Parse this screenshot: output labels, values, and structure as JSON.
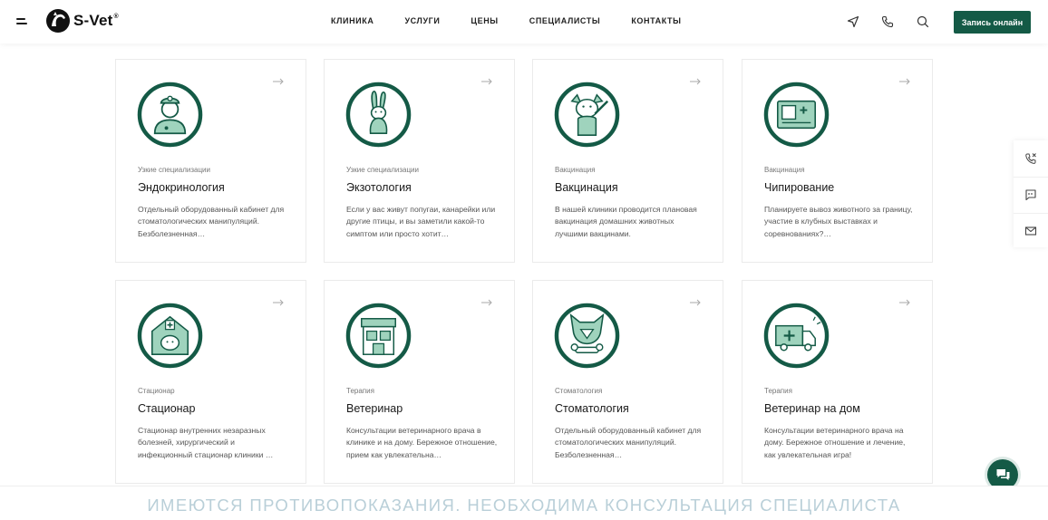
{
  "header": {
    "brand": "S-Vet",
    "brand_mark": "®",
    "nav": [
      "КЛИНИКА",
      "УСЛУГИ",
      "ЦЕНЫ",
      "СПЕЦИАЛИСТЫ",
      "КОНТАКТЫ"
    ],
    "cta_label": "Запись онлайн",
    "icons": [
      "location-arrow-icon",
      "phone-icon",
      "search-icon"
    ]
  },
  "cards": [
    {
      "category": "Узкие специализации",
      "title": "Эндокринология",
      "desc": "Отдельный оборудованный кабинет для стоматологических манипуляций. Безболезненная…",
      "icon": "doctor-icon"
    },
    {
      "category": "Узкие специализации",
      "title": "Экзотология",
      "desc": "Если у вас живут попугаи, канарейки или другие птицы, и вы заметили какой-то симптом или просто хотит…",
      "icon": "rabbit-icon"
    },
    {
      "category": "Вакцинация",
      "title": "Вакцинация",
      "desc": "В  нашей клиники проводится плановая вакцинация домашних животных лучшими вакцинами.",
      "icon": "dog-syringe-icon"
    },
    {
      "category": "Вакцинация",
      "title": "Чипирование",
      "desc": "Планируете вывоз животного за границу, участие в клубных выставках и соревнованиях?…",
      "icon": "pet-passport-icon"
    },
    {
      "category": "Стационар",
      "title": "Стационар",
      "desc": "Стационар внутренних незаразных болезней, хирургический и инфекционный стационар клиники …",
      "icon": "pet-hospital-icon"
    },
    {
      "category": "Терапия",
      "title": "Ветеринар",
      "desc": "Консультации ветеринарного врача в клинике и на дому. Бережное отношение, прием как увлекательна…",
      "icon": "vet-building-icon"
    },
    {
      "category": "Стоматология",
      "title": "Стоматология",
      "desc": "Отдельный оборудованный кабинет для стоматологических манипуляций. Безболезненная…",
      "icon": "dog-bone-icon"
    },
    {
      "category": "Терапия",
      "title": "Ветеринар на дом",
      "desc": "Консультации ветеринарного врача на дому. Бережное отношение и лечение, как увлекательная игра!",
      "icon": "ambulance-icon"
    }
  ],
  "sidebar": {
    "icons": [
      "callback-icon",
      "message-icon",
      "mail-icon"
    ]
  },
  "chat": {
    "icon": "chat-icon"
  },
  "footer": {
    "warning": "ИМЕЮТСЯ ПРОТИВОПОКАЗАНИЯ. НЕОБХОДИМА КОНСУЛЬТАЦИЯ СПЕЦИАЛИСТА"
  },
  "colors": {
    "brand": "#145a46",
    "icon_bg": "#ffffff",
    "icon_fill": "#9fd3bd",
    "warning_text": "#b9cfd8"
  }
}
